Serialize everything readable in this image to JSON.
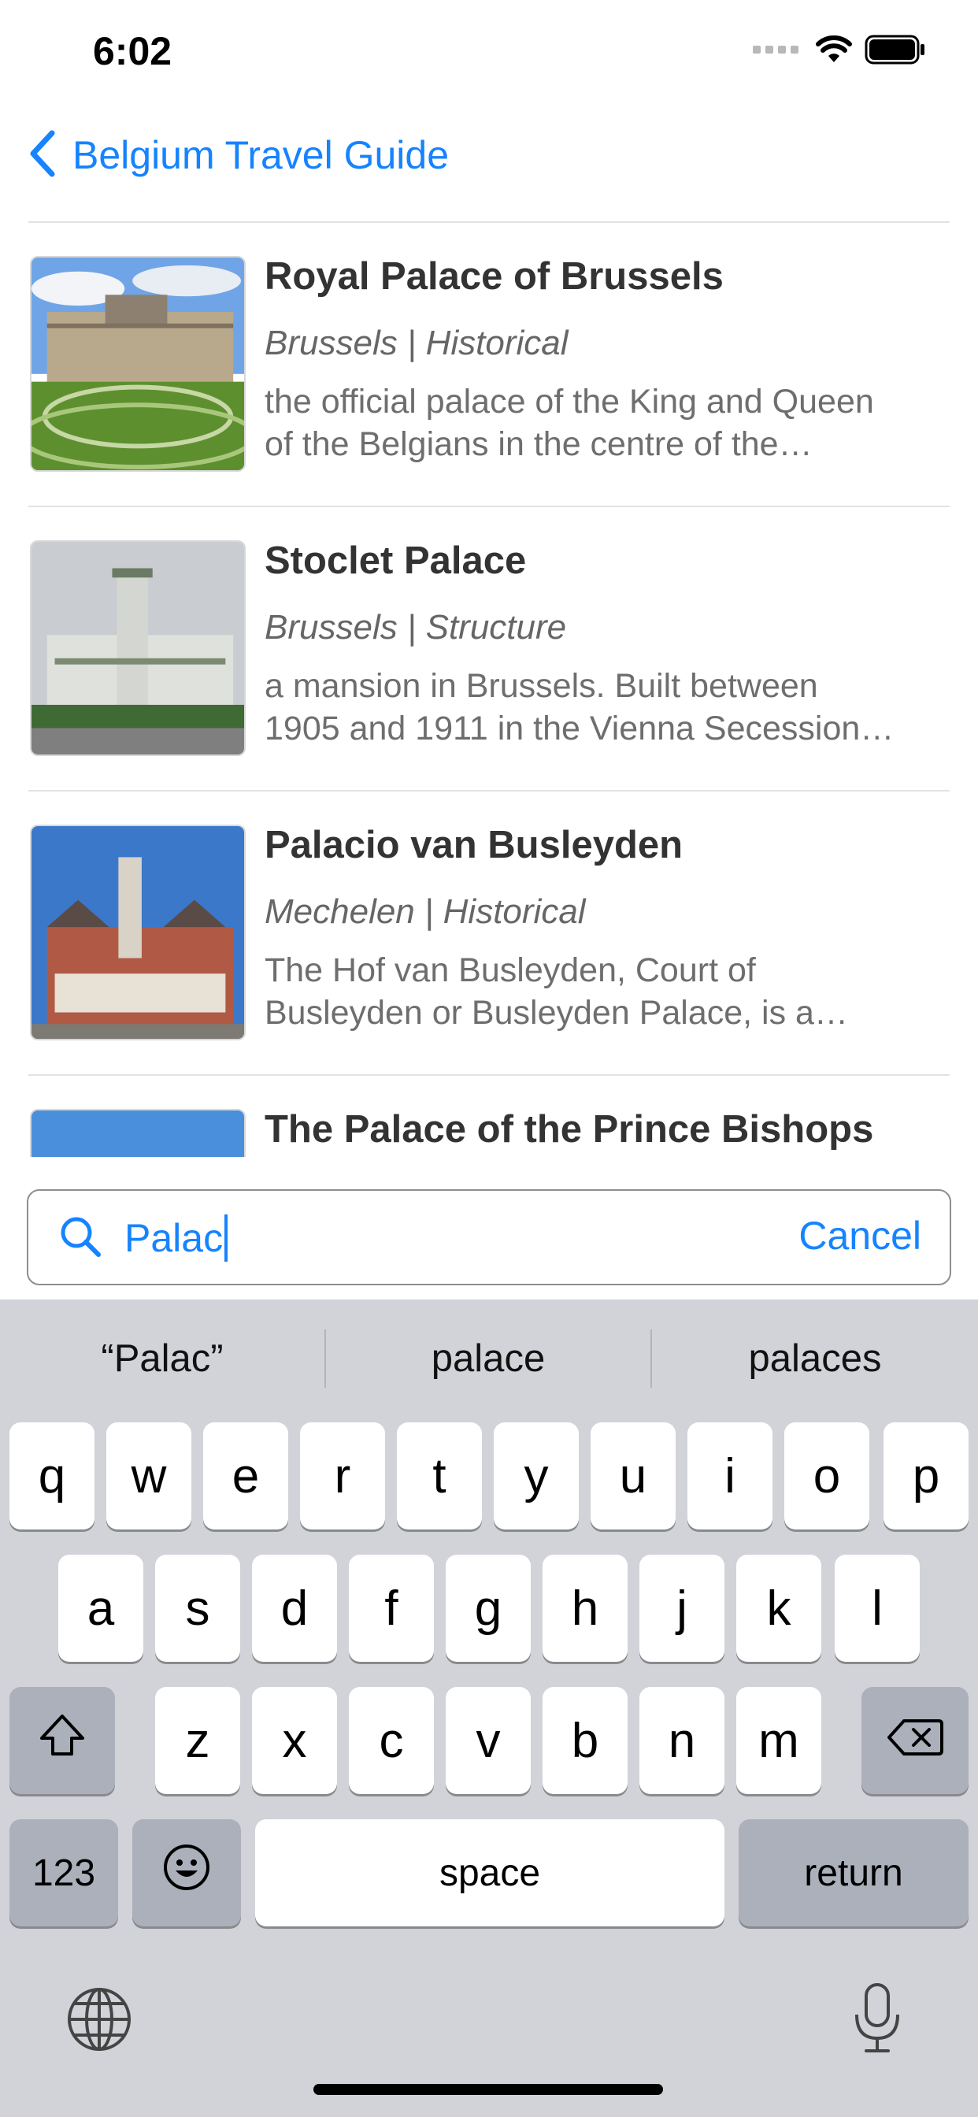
{
  "status_bar": {
    "time": "6:02"
  },
  "nav": {
    "back_label": "Belgium Travel Guide"
  },
  "list": {
    "items": [
      {
        "title": "Royal Palace of Brussels",
        "subtitle": "Brussels | Historical",
        "desc_line1": "the official palace of the King and Queen",
        "desc_line2": "of the Belgians in the centre of the…"
      },
      {
        "title": "Stoclet Palace",
        "subtitle": "Brussels | Structure",
        "desc_line1": "a mansion in Brussels. Built between",
        "desc_line2": "1905 and 1911 in the Vienna Secession…"
      },
      {
        "title": "Palacio van Busleyden",
        "subtitle": "Mechelen | Historical",
        "desc_line1": "The Hof van Busleyden, Court of",
        "desc_line2": "Busleyden or Busleyden Palace, is a…"
      },
      {
        "title": "The Palace of the Prince Bishops"
      }
    ]
  },
  "search": {
    "value": "Palac",
    "cancel_label": "Cancel"
  },
  "keyboard": {
    "suggestions": [
      "“Palac”",
      "palace",
      "palaces"
    ],
    "row1": [
      "q",
      "w",
      "e",
      "r",
      "t",
      "y",
      "u",
      "i",
      "o",
      "p"
    ],
    "row2": [
      "a",
      "s",
      "d",
      "f",
      "g",
      "h",
      "j",
      "k",
      "l"
    ],
    "row3": [
      "z",
      "x",
      "c",
      "v",
      "b",
      "n",
      "m"
    ],
    "numbers_label": "123",
    "space_label": "space",
    "return_label": "return"
  },
  "icons": {
    "back": "chevron-left-icon",
    "search": "magnifier-icon",
    "wifi": "wifi-icon",
    "battery": "battery-icon",
    "shift": "shift-icon",
    "delete": "delete-icon",
    "emoji": "emoji-icon",
    "globe": "globe-icon",
    "mic": "microphone-icon"
  },
  "colors": {
    "accent": "#1683ff",
    "keyboard_bg": "#d1d3d9",
    "dark_key": "#abb0bb"
  }
}
